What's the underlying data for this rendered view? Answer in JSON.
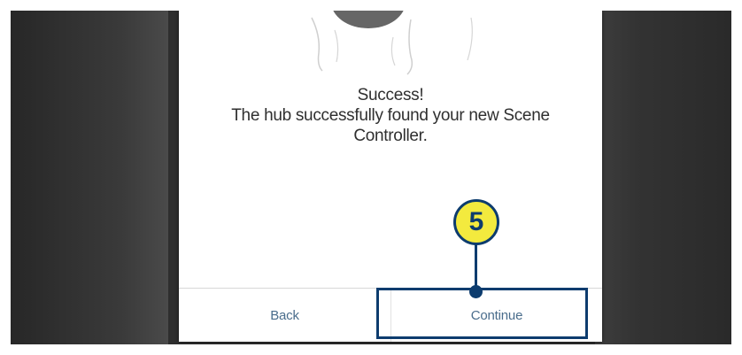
{
  "dialog": {
    "title": "Success!",
    "message_line1": "The hub successfully found your new Scene",
    "message_line2": "Controller."
  },
  "buttons": {
    "back_label": "Back",
    "continue_label": "Continue"
  },
  "callout": {
    "step_number": "5"
  },
  "colors": {
    "button_text": "#4a6d8c",
    "callout_border": "#0d3c6e",
    "callout_fill": "#f3ea3e",
    "background_dark": "#2e2e2e"
  }
}
